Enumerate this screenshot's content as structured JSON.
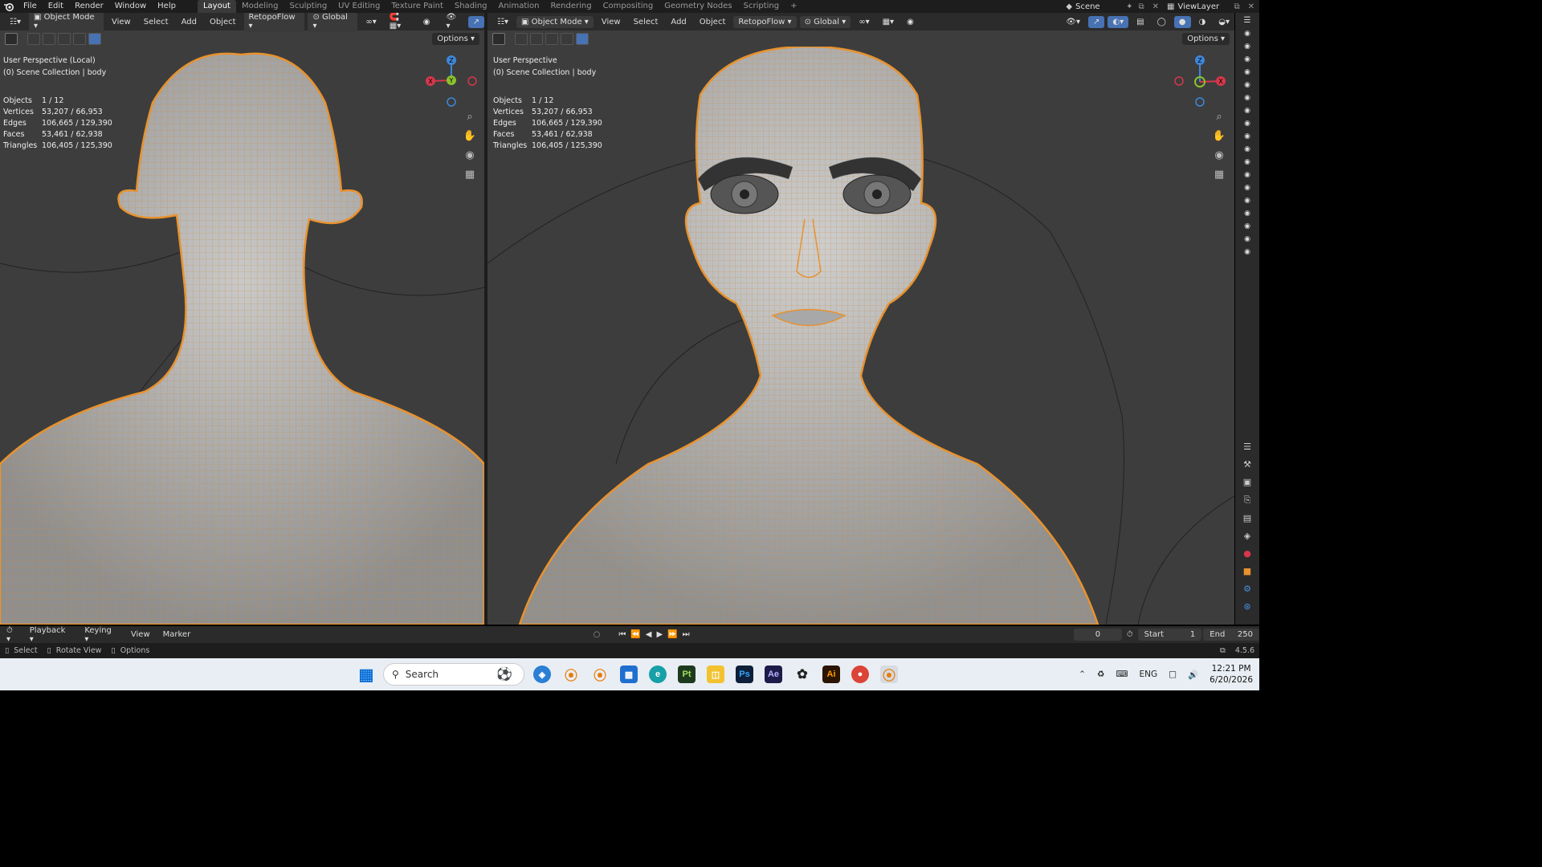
{
  "menu": {
    "file": "File",
    "edit": "Edit",
    "render": "Render",
    "window": "Window",
    "help": "Help"
  },
  "workspaces": [
    "Layout",
    "Modeling",
    "Sculpting",
    "UV Editing",
    "Texture Paint",
    "Shading",
    "Animation",
    "Rendering",
    "Compositing",
    "Geometry Nodes",
    "Scripting",
    "+"
  ],
  "active_workspace": "Layout",
  "scene": "Scene",
  "view_layer": "ViewLayer",
  "viewport_left": {
    "mode": "Object Mode",
    "view": "View",
    "select": "Select",
    "add": "Add",
    "object": "Object",
    "addon": "RetopoFlow",
    "orientation": "Global",
    "options": "Options",
    "perspective": "User Perspective (Local)",
    "collection": "(0) Scene Collection | body",
    "stats": {
      "objects_label": "Objects",
      "objects": "1 / 12",
      "vertices_label": "Vertices",
      "vertices": "53,207 / 66,953",
      "edges_label": "Edges",
      "edges": "106,665 / 129,390",
      "faces_label": "Faces",
      "faces": "53,461 / 62,938",
      "triangles_label": "Triangles",
      "triangles": "106,405 / 125,390"
    }
  },
  "viewport_right": {
    "mode": "Object Mode",
    "view": "View",
    "select": "Select",
    "add": "Add",
    "object": "Object",
    "addon": "RetopoFlow",
    "orientation": "Global",
    "options": "Options",
    "perspective": "User Perspective",
    "collection": "(0) Scene Collection | body",
    "stats": {
      "objects_label": "Objects",
      "objects": "1 / 12",
      "vertices_label": "Vertices",
      "vertices": "53,207 / 66,953",
      "edges_label": "Edges",
      "edges": "106,665 / 129,390",
      "faces_label": "Faces",
      "faces": "53,461 / 62,938",
      "triangles_label": "Triangles",
      "triangles": "106,405 / 125,390"
    }
  },
  "gizmo": {
    "x": "X",
    "y": "Y",
    "z": "Z"
  },
  "timeline": {
    "playback": "Playback",
    "keying": "Keying",
    "view": "View",
    "marker": "Marker",
    "current_frame": "0",
    "start_label": "Start",
    "start": "1",
    "end_label": "End",
    "end": "250"
  },
  "statusbar": {
    "select": "Select",
    "rotate": "Rotate View",
    "options": "Options",
    "version": "4.5.6"
  },
  "taskbar": {
    "search_placeholder": "Search",
    "lang": "ENG",
    "time": "12:21 PM",
    "date": "6/20/2026"
  },
  "colors": {
    "accent": "#4772b3",
    "wire": "#e8922e",
    "skin": "#b5b5b5",
    "axis_x": "#d6374c",
    "axis_y": "#8ac12d",
    "axis_z": "#3e87d8"
  }
}
